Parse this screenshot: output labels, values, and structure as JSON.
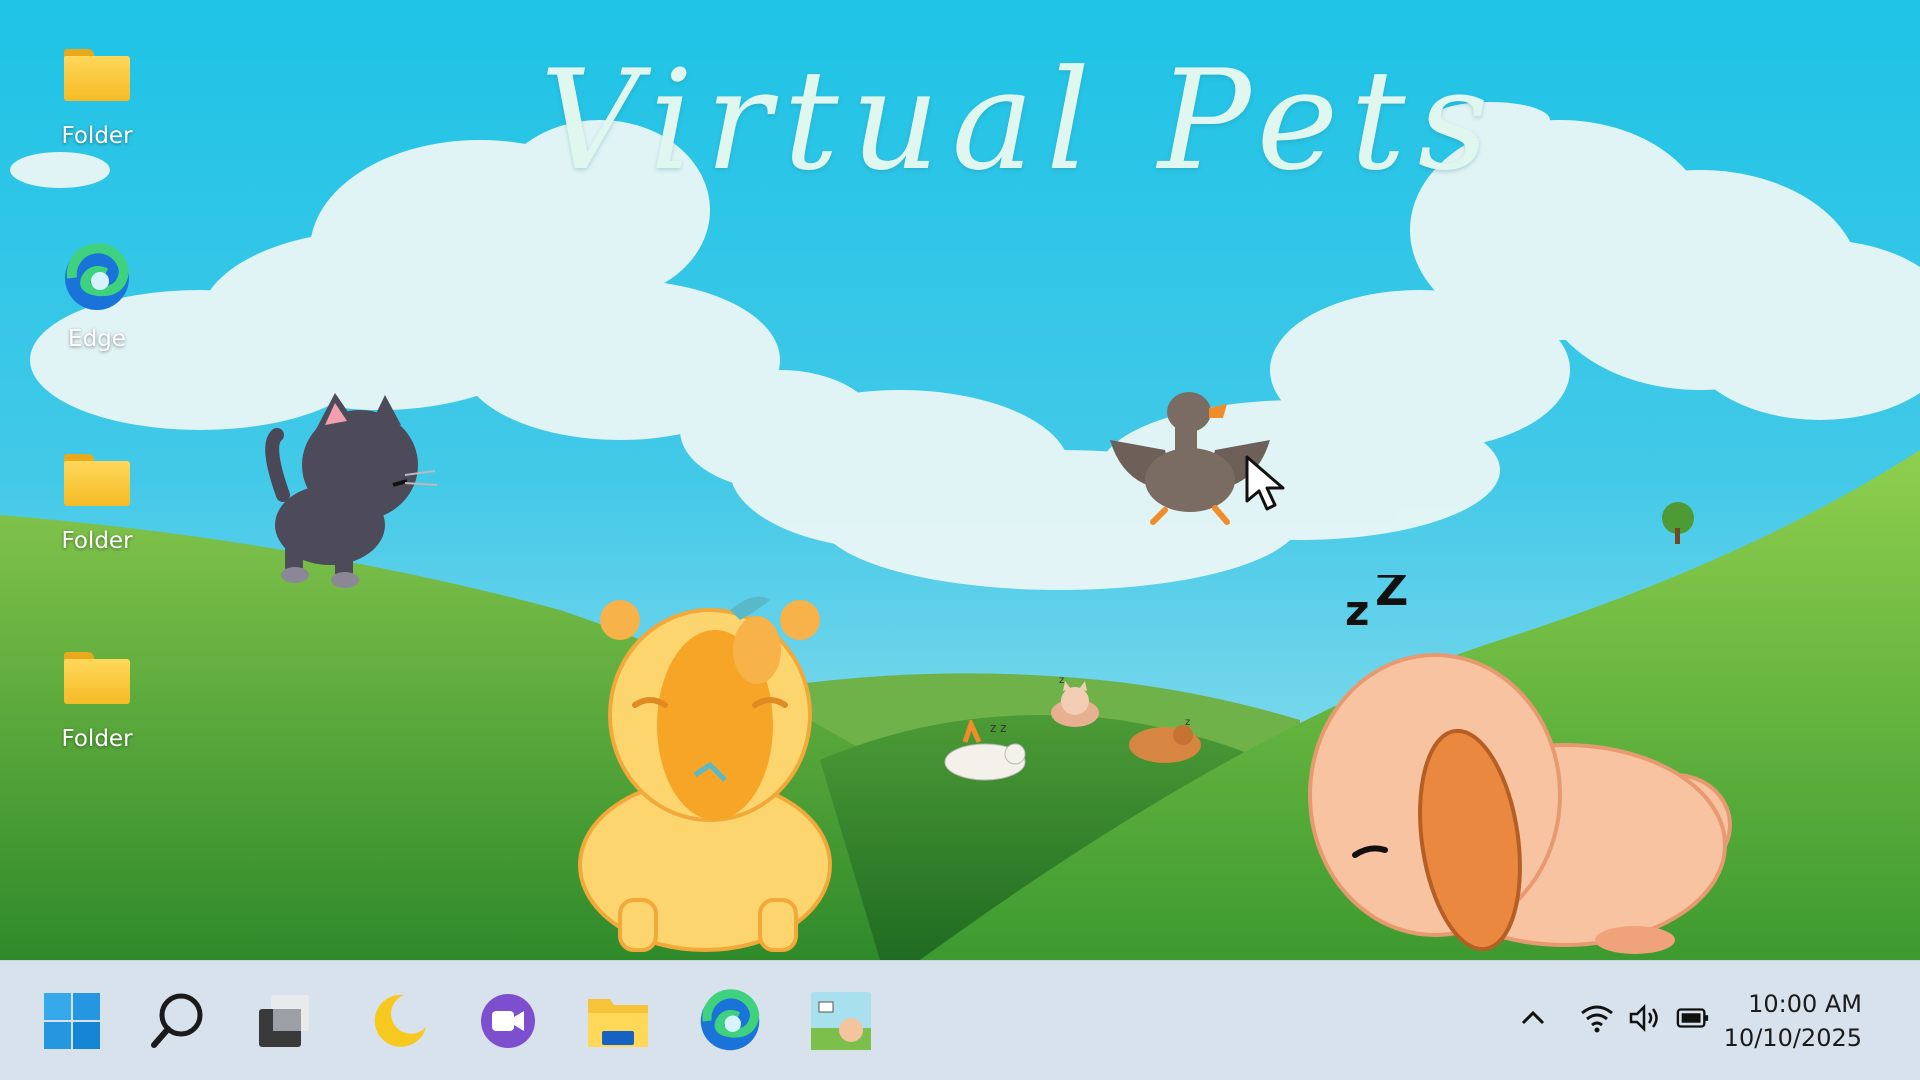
{
  "wallpaper": {
    "title": "Virtual Pets",
    "sky_color": "#1ec3e6",
    "grass_color": "#4aa33a"
  },
  "desktop_icons": [
    {
      "label": "Folder",
      "icon": "folder-icon"
    },
    {
      "label": "Edge",
      "icon": "edge-icon"
    },
    {
      "label": "Folder",
      "icon": "folder-icon"
    },
    {
      "label": "Folder",
      "icon": "folder-icon"
    }
  ],
  "pets": [
    {
      "name": "cat",
      "state": "walking"
    },
    {
      "name": "goose",
      "state": "flying"
    },
    {
      "name": "capybara",
      "state": "standing"
    },
    {
      "name": "puppy",
      "state": "sleeping",
      "sleep_text": "Z z"
    },
    {
      "name": "cat-small",
      "state": "sleeping"
    },
    {
      "name": "goose-small",
      "state": "sleeping"
    },
    {
      "name": "capybara-small",
      "state": "sleeping"
    }
  ],
  "taskbar": {
    "apps": [
      "start-icon",
      "search-icon",
      "task-view-icon",
      "moon-app-icon",
      "video-app-icon",
      "file-explorer-icon",
      "edge-icon",
      "virtual-pets-app-icon"
    ],
    "tray": [
      "chevron-up-icon",
      "wifi-icon",
      "volume-icon",
      "battery-icon"
    ],
    "time": "10:00 AM",
    "date": "10/10/2025"
  }
}
